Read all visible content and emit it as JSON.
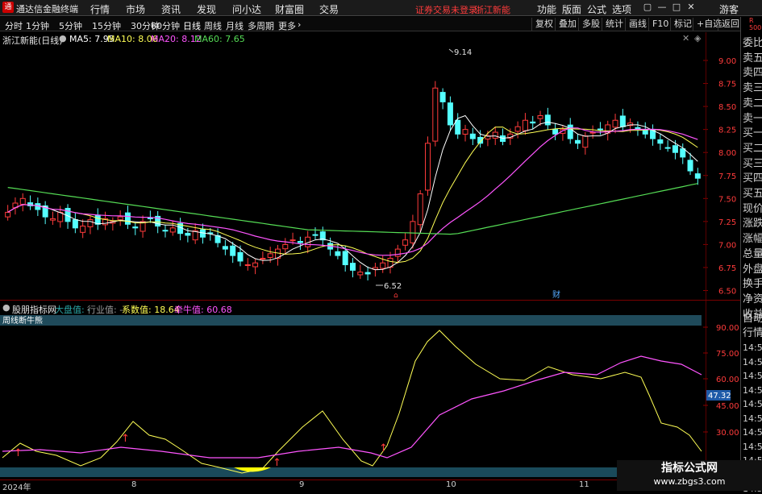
{
  "menubar": {
    "app_title": "通达信金融终端",
    "menus": [
      "行情",
      "市场",
      "资讯",
      "发现",
      "问小达",
      "财富圈",
      "交易"
    ],
    "login_status": "证券交易未登录",
    "stock_name": "浙江新能",
    "right_menus": [
      "功能",
      "版面",
      "公式",
      "选项"
    ],
    "user": "游客"
  },
  "toolbar": {
    "periods": [
      "分时",
      "1分钟",
      "5分钟",
      "15分钟",
      "30分钟",
      "60分钟",
      "日线",
      "周线",
      "月线",
      "多周期",
      "更多"
    ],
    "active_period": "日线",
    "buttons": [
      "复权",
      "叠加",
      "多股",
      "统计",
      "画线",
      "F10",
      "标记",
      "+自选",
      "返回"
    ]
  },
  "main_info": {
    "title": "浙江新能(日线)",
    "ma5_label": "MA5: 7.95",
    "ma10_label": "MA10: 8.06",
    "ma20_label": "MA20: 8.12",
    "ma60_label": "MA60: 7.65"
  },
  "price_axis": {
    "ticks": [
      "9.00",
      "8.75",
      "8.50",
      "8.25",
      "8.00",
      "7.75",
      "7.50",
      "7.25",
      "7.00",
      "6.75",
      "6.50"
    ]
  },
  "annotations": {
    "high_label": "9.14",
    "low_label": "6.52",
    "finance_mark": "财"
  },
  "sub_info": {
    "title": "股朋指标网",
    "item1": "大盘值: -",
    "item2": "行业值: -",
    "item3": "系数值: 18.64",
    "item4": "牵牛值: 60.68",
    "panel_title": "周线断牛熊"
  },
  "sub_axis": {
    "ticks": [
      "90.00",
      "75.00",
      "60.00",
      "45.00",
      "30.00"
    ],
    "current_value": "47.32"
  },
  "dates": [
    "2024年",
    "8",
    "9",
    "10",
    "11"
  ],
  "side_order": {
    "items": [
      "委比",
      "卖五",
      "卖四",
      "卖三",
      "卖二",
      "卖一",
      "买一",
      "买二",
      "买三",
      "买四",
      "买五",
      "现价",
      "涨跌",
      "涨幅",
      "总量",
      "外盘",
      "换手",
      "净资",
      "收益",
      "自动",
      "行情"
    ],
    "times": [
      "14:56",
      "14:56",
      "14:56",
      "14:56",
      "14:56",
      "14:56",
      "14:56",
      "14:56",
      "14:56",
      "14:56",
      "14:56"
    ],
    "corner": "R 500"
  },
  "watermark": {
    "title": "指标公式网",
    "url": "www.zbgs3.com"
  },
  "colors": {
    "up": "#ff3b3b",
    "down": "#54ffff",
    "ma5": "#ffffff",
    "ma10": "#ffff55",
    "ma20": "#ff55ff",
    "ma60": "#55dd55"
  }
}
